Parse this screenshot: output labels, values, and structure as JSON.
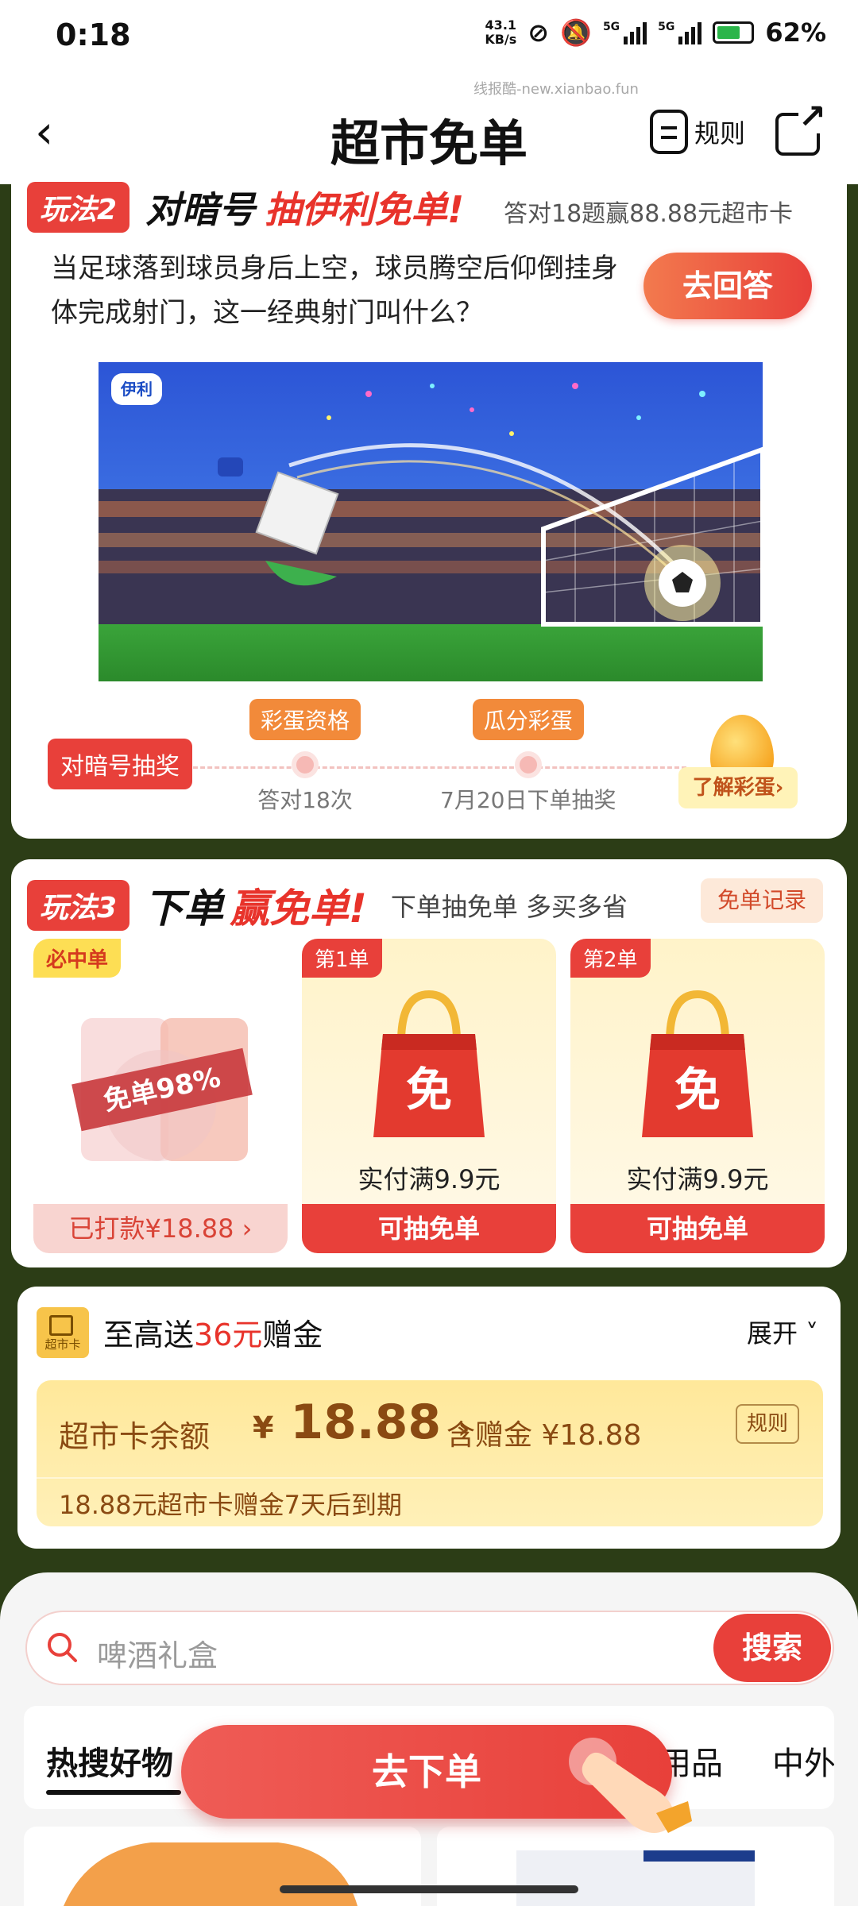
{
  "status": {
    "time": "0:18",
    "netspeed_value": "43.1",
    "netspeed_unit": "KB/s",
    "sig1": "5G",
    "sig2": "5G",
    "battery": "62%"
  },
  "watermark": "线报酷-new.xianbao.fun",
  "header": {
    "back_glyph": "‹",
    "title": "超市免单",
    "rules_label": "规则"
  },
  "play2": {
    "tag": "玩法2",
    "title_a": "对暗号",
    "title_b": "抽伊利免单!",
    "subtitle": "答对18题赢88.88元超市卡",
    "question": "当足球落到球员身后上空，球员腾空后仰倒挂身体完成射门，这一经典射门叫什么？",
    "answer_button": "去回答",
    "lottery_tag": "对暗号抽奖",
    "milestones": [
      {
        "label": "彩蛋资格",
        "text": "答对18次"
      },
      {
        "label": "瓜分彩蛋",
        "text": "7月20日下单抽奖"
      }
    ],
    "egg_button": "了解彩蛋›"
  },
  "play3": {
    "tag": "玩法3",
    "title_a": "下单",
    "title_b": "赢免单!",
    "subtitle": "下单抽免单 多买多省",
    "record_button": "免单记录",
    "cards": [
      {
        "tag": "必中单",
        "stamp": "免单98%",
        "bottom": "已打款¥18.88 ›"
      },
      {
        "tag": "第1单",
        "price": "实付满9.9元",
        "bottom": "可抽免单"
      },
      {
        "tag": "第2单",
        "price": "实付满9.9元",
        "bottom": "可抽免单"
      }
    ]
  },
  "supercard": {
    "icon_text": "超市卡",
    "title_prefix": "至高送",
    "title_amount": "36元",
    "title_suffix": "赠金",
    "expand": "展开 ˅",
    "balance_label": "超市卡余额",
    "currency": "¥",
    "balance": "18.88",
    "chevron": "›",
    "gift_label": "含赠金 ¥18.88",
    "rules": "规则",
    "expire_note": "18.88元超市卡赠金7天后到期"
  },
  "search": {
    "placeholder": "啤酒礼盒",
    "button": "搜索"
  },
  "tabs": [
    "热搜好物",
    "用品",
    "中外"
  ],
  "fab": {
    "label": "去下单"
  },
  "colors": {
    "accent": "#e8403a",
    "gold": "#f7c44a",
    "bg_dark_green": "#2c3d16"
  }
}
